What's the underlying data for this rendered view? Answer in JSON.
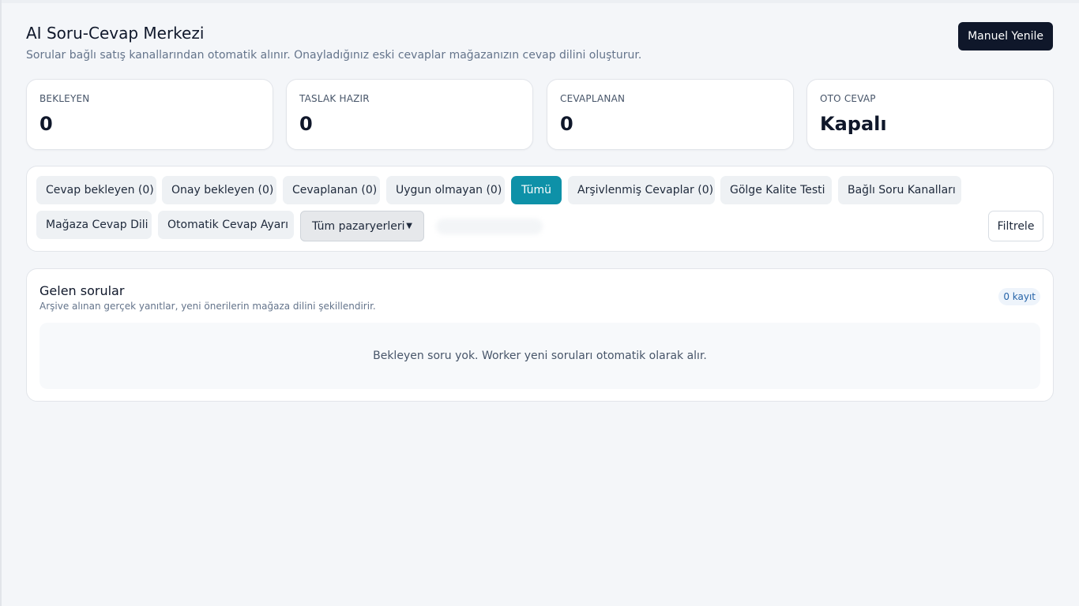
{
  "header": {
    "title": "AI Soru-Cevap Merkezi",
    "subtitle": "Sorular bağlı satış kanallarından otomatik alınır. Onayladığınız eski cevaplar mağazanızın cevap dilini oluşturur.",
    "refresh_label": "Manuel Yenile"
  },
  "stats": [
    {
      "label": "BEKLEYEN",
      "value": "0"
    },
    {
      "label": "TASLAK HAZIR",
      "value": "0"
    },
    {
      "label": "CEVAPLANAN",
      "value": "0"
    },
    {
      "label": "OTO CEVAP",
      "value": "Kapalı"
    }
  ],
  "filters": {
    "tabs": [
      {
        "label": "Cevap bekleyen (0)",
        "active": false
      },
      {
        "label": "Onay bekleyen (0)",
        "active": false
      },
      {
        "label": "Cevaplanan (0)",
        "active": false
      },
      {
        "label": "Uygun olmayan (0)",
        "active": false
      },
      {
        "label": "Tümü",
        "active": true
      },
      {
        "label": "Arşivlenmiş Cevaplar (0)",
        "active": false
      },
      {
        "label": "Gölge Kalite Testi",
        "active": false
      },
      {
        "label": "Bağlı Soru Kanalları",
        "active": false
      },
      {
        "label": "Mağaza Cevap Dili",
        "active": false
      },
      {
        "label": "Otomatik Cevap Ayarı",
        "active": false
      }
    ],
    "marketplace_selected": "Tüm pazaryerleri",
    "filter_button": "Filtrele"
  },
  "questions": {
    "title": "Gelen sorular",
    "subtitle": "Arşive alınan gerçek yanıtlar, yeni önerilerin mağaza dilini şekillendirir.",
    "count_badge": "0 kayıt",
    "empty_message": "Bekleyen soru yok. Worker yeni soruları otomatik olarak alır."
  },
  "colors": {
    "accent": "#0e91a8",
    "primary_button": "#0f172a"
  }
}
